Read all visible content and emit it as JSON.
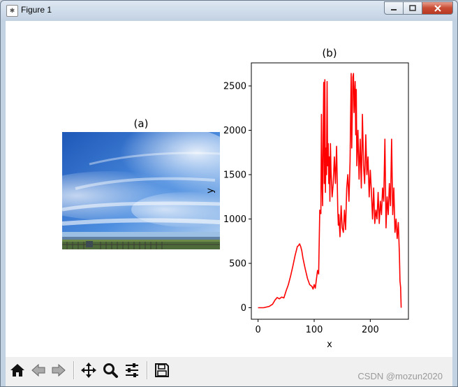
{
  "window": {
    "title": "Figure 1",
    "minimize_icon": "minimize-icon",
    "maximize_icon": "maximize-icon",
    "close_icon": "close-icon"
  },
  "figure": {
    "left_title": "(a)",
    "right_title": "(b)",
    "image_description_icon": "sky-photo"
  },
  "chart_data": {
    "type": "line",
    "title": "(b)",
    "xlabel": "x",
    "ylabel": "y",
    "xlim": [
      -12,
      268
    ],
    "ylim": [
      -130,
      2760
    ],
    "xticks": [
      0,
      100,
      200
    ],
    "yticks": [
      0,
      500,
      1000,
      1500,
      2000,
      2500
    ],
    "series": [
      {
        "color": "#ff0000",
        "x": [
          0,
          10,
          20,
          26,
          30,
          34,
          38,
          42,
          46,
          50,
          54,
          58,
          62,
          66,
          70,
          72,
          74,
          76,
          78,
          80,
          84,
          88,
          92,
          96,
          98,
          100,
          102,
          104,
          106,
          108,
          110,
          112,
          113,
          114,
          115,
          116,
          117,
          118,
          119,
          120,
          121,
          122,
          123,
          124,
          125,
          126,
          127,
          128,
          129,
          130,
          132,
          134,
          136,
          138,
          140,
          142,
          143,
          144,
          146,
          148,
          150,
          152,
          154,
          156,
          158,
          160,
          162,
          164,
          166,
          167,
          168,
          169,
          170,
          171,
          172,
          173,
          174,
          175,
          176,
          178,
          180,
          182,
          184,
          186,
          188,
          190,
          192,
          194,
          196,
          198,
          200,
          202,
          204,
          206,
          208,
          210,
          212,
          214,
          216,
          218,
          220,
          222,
          224,
          226,
          228,
          230,
          232,
          234,
          236,
          238,
          240,
          242,
          244,
          246,
          248,
          250,
          252,
          253,
          254,
          255
        ],
        "values": [
          0,
          0,
          15,
          40,
          85,
          115,
          100,
          120,
          110,
          190,
          260,
          360,
          470,
          590,
          690,
          700,
          720,
          690,
          640,
          560,
          440,
          330,
          260,
          240,
          210,
          260,
          220,
          320,
          420,
          380,
          1100,
          1060,
          2180,
          1400,
          1150,
          1950,
          2540,
          1400,
          2570,
          1300,
          1800,
          1500,
          2550,
          1600,
          1850,
          1400,
          1700,
          1200,
          1850,
          1550,
          1250,
          1400,
          1700,
          1400,
          1820,
          1100,
          930,
          1050,
          800,
          1150,
          900,
          850,
          1100,
          880,
          1350,
          1500,
          1200,
          1650,
          2640,
          1800,
          2200,
          2600,
          2640,
          2200,
          2400,
          2550,
          1950,
          2460,
          1600,
          2000,
          1450,
          1900,
          1350,
          2180,
          1600,
          1400,
          1950,
          1500,
          1700,
          1250,
          1550,
          1300,
          1000,
          1350,
          950,
          1100,
          1000,
          1300,
          950,
          1200,
          1050,
          1350,
          1200,
          1900,
          900,
          1250,
          1050,
          1400,
          1150,
          1900,
          1050,
          1350,
          850,
          1000,
          780,
          960,
          600,
          300,
          230,
          0
        ]
      }
    ]
  },
  "toolbar": {
    "home_icon": "home-icon",
    "back_icon": "back-arrow-icon",
    "forward_icon": "forward-arrow-icon",
    "pan_icon": "pan-icon",
    "zoom_icon": "zoom-icon",
    "configure_icon": "configure-subplots-icon",
    "save_icon": "save-icon"
  },
  "watermark": "CSDN @mozun2020"
}
